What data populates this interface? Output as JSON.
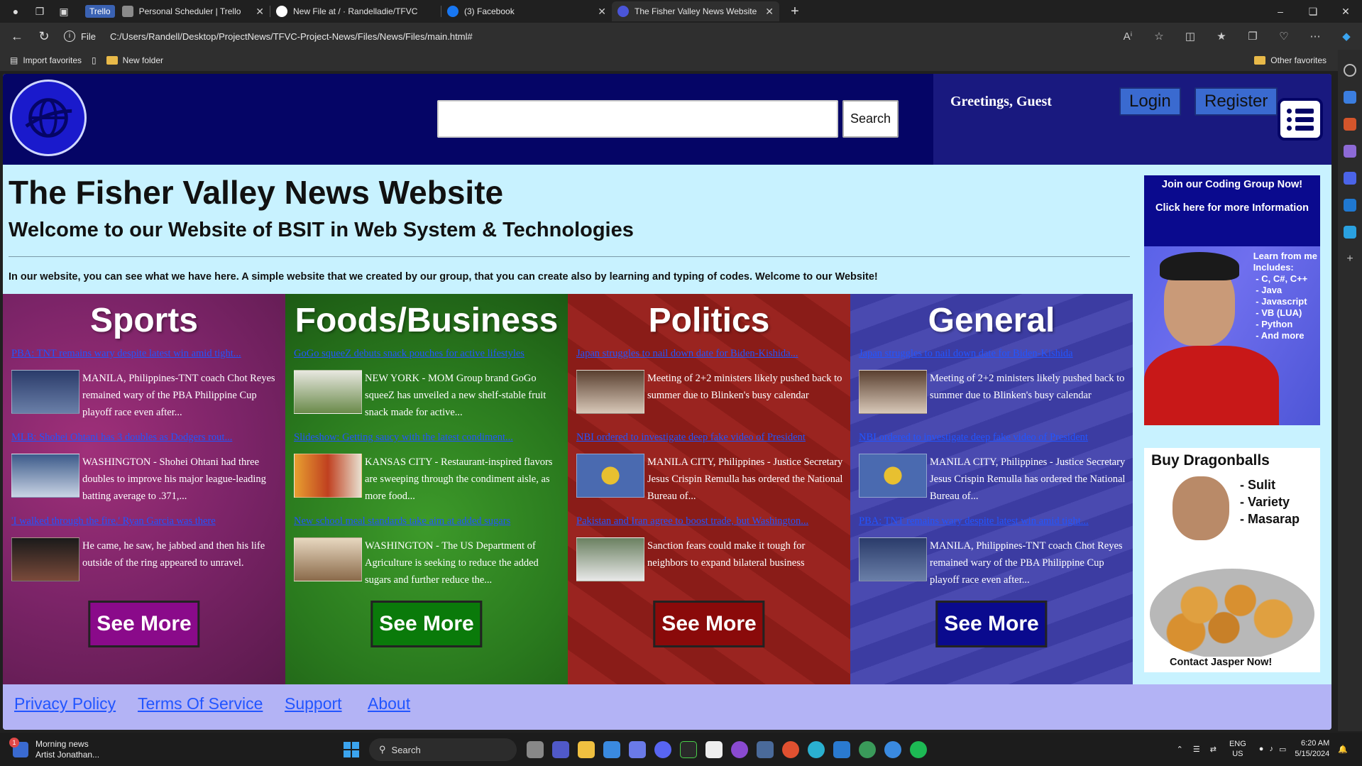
{
  "browser": {
    "tabs": [
      {
        "label": "Personal Scheduler | Trello",
        "chip": "Trello",
        "icon": "trello-icon",
        "color": "#3a62b3"
      },
      {
        "label": "New File at / · Randelladie/TFVC",
        "icon": "github-icon",
        "color": "#ffffff"
      },
      {
        "label": "(3) Facebook",
        "icon": "facebook-icon",
        "color": "#1877f2"
      },
      {
        "label": "The Fisher Valley News Website",
        "icon": "globe-icon",
        "color": "#4a55d8",
        "active": true
      }
    ],
    "address": {
      "prefix": "File",
      "url": "C:/Users/Randell/Desktop/ProjectNews/TFVC-Project-News/Files/News/Files/main.html#"
    },
    "favorites": {
      "import": "Import favorites",
      "folder": "New folder",
      "other": "Other favorites"
    }
  },
  "site": {
    "search_button": "Search",
    "greeting": "Greetings, Guest",
    "login": "Login",
    "register": "Register",
    "title": "The Fisher Valley News Website",
    "subtitle": "Welcome to our Website of BSIT in Web System & Technologies",
    "intro": "In our website, you can see what we have here. A simple website that we created by our group, that you can create also by learning and typing of codes. Welcome to our Website!",
    "categories": [
      {
        "name": "Sports",
        "see_more": "See More",
        "button_color": "#8a0a8a",
        "items": [
          {
            "headline": "PBA: TNT remains wary despite latest win amid tight...",
            "summary": "MANILA, Philippines-TNT coach Chot Reyes remained wary of the PBA Philippine Cup playoff race even after..."
          },
          {
            "headline": "MLB: Shohei Ohtani has 3 doubles as Dodgers rout...",
            "summary": "WASHINGTON - Shohei Ohtani had three doubles to improve his major league-leading batting average to .371,..."
          },
          {
            "headline": "'I walked through the fire.' Ryan Garcia was there",
            "summary": "He came, he saw, he jabbed and then his life outside of the ring appeared to unravel."
          }
        ]
      },
      {
        "name": "Foods/Business",
        "see_more": "See More",
        "button_color": "#0a7a0a",
        "items": [
          {
            "headline": "GoGo squeeZ debuts snack pouches for active lifestyles",
            "summary": "NEW YORK - MOM Group brand GoGo squeeZ has unveiled a new shelf-stable fruit snack made for active..."
          },
          {
            "headline": "Slideshow: Getting saucy with the latest condiment...",
            "summary": "KANSAS CITY - Restaurant-inspired flavors are sweeping through the condiment aisle, as more food..."
          },
          {
            "headline": "New school meal standards take aim at added sugars",
            "summary": "WASHINGTON - The US Department of Agriculture is seeking to reduce the added sugars and further reduce the..."
          }
        ]
      },
      {
        "name": "Politics",
        "see_more": "See More",
        "button_color": "#8a0a0a",
        "items": [
          {
            "headline": "Japan struggles to nail down date for Biden-Kishida...",
            "summary": "Meeting of 2+2 ministers likely pushed back to summer due to Blinken's busy calendar"
          },
          {
            "headline": "NBI ordered to investigate deep fake video of President",
            "summary": "MANILA CITY, Philippines - Justice Secretary Jesus Crispin Remulla has ordered the National Bureau of..."
          },
          {
            "headline": "Pakistan and Iran agree to boost trade, but Washington...",
            "summary": "Sanction fears could make it tough for neighbors to expand bilateral business"
          }
        ]
      },
      {
        "name": "General",
        "see_more": "See More",
        "button_color": "#0a0a8e",
        "items": [
          {
            "headline": "Japan struggles to nail down date for Biden-Kishida",
            "summary": "Meeting of 2+2 ministers likely pushed back to summer due to Blinken's busy calendar"
          },
          {
            "headline": "NBI ordered to investigate deep fake video of President",
            "summary": "MANILA CITY, Philippines - Justice Secretary Jesus Crispin Remulla has ordered the National Bureau of..."
          },
          {
            "headline": "PBA: TNT remains wary despite latest win amid tight...",
            "summary": "MANILA, Philippines-TNT coach Chot Reyes remained wary of the PBA Philippine Cup playoff race even after..."
          }
        ]
      }
    ],
    "ads": {
      "coding": {
        "line1": "Join our Coding Group Now!",
        "line2": "Click here for more Information",
        "learn": "Learn from me\nIncludes:\n - C, C#, C++\n - Java\n - Javascript\n - VB (LUA)\n - Python\n - And more"
      },
      "dragonballs": {
        "title": "Buy Dragonballs",
        "bullets": "- Sulit\n- Variety\n- Masarap",
        "contact": "Contact Jasper Now!"
      }
    },
    "footer": [
      "Privacy Policy",
      "Terms Of Service",
      "Support",
      "About"
    ]
  },
  "taskbar": {
    "news_title": "Morning news",
    "news_sub": "Artist Jonathan...",
    "news_badge": "1",
    "search": "Search",
    "lang1": "ENG",
    "lang2": "US",
    "time": "6:20 AM",
    "date": "5/15/2024"
  }
}
